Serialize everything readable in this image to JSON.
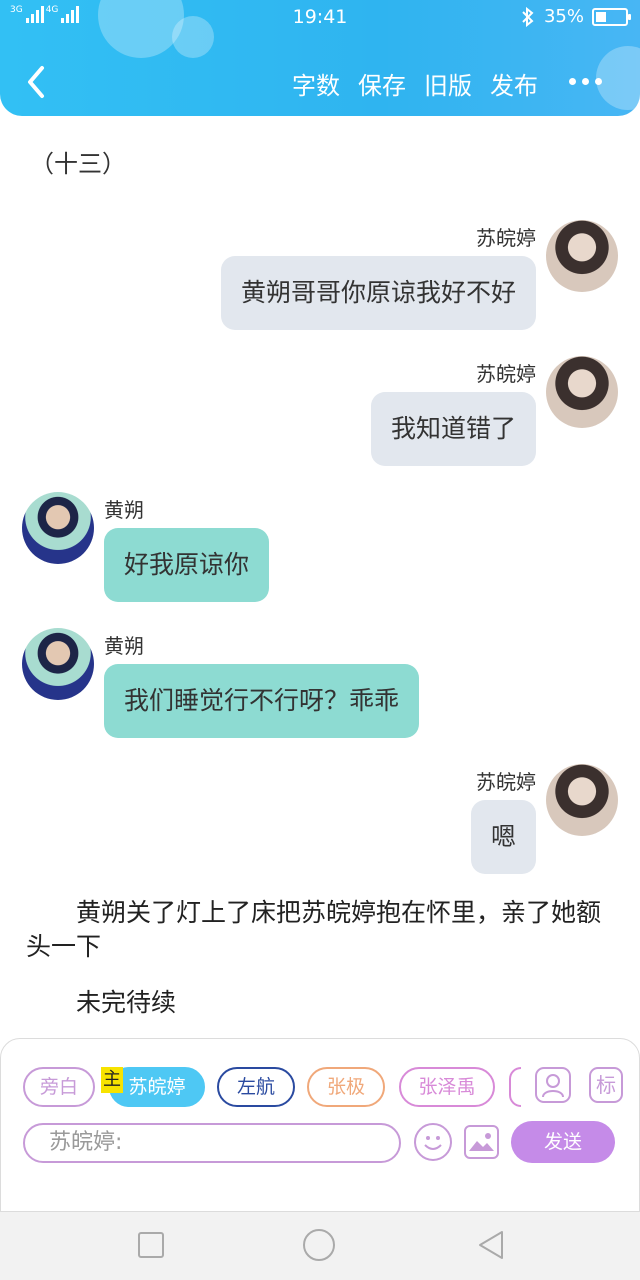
{
  "status_bar": {
    "network_1": "3G",
    "network_2": "4G",
    "time": "19:41",
    "battery": "35%",
    "battery_level": 0.35
  },
  "toolbar": {
    "actions": [
      "字数",
      "保存",
      "旧版",
      "发布"
    ],
    "back_icon": "chevron-left-icon",
    "more_icon": "more-dots-icon"
  },
  "story": {
    "chapter_title": "（十三）",
    "messages": [
      {
        "speaker": "苏皖婷",
        "text": "黄朔哥哥你原谅我好不好",
        "side": "right",
        "avatar": "avatar-girl"
      },
      {
        "speaker": "苏皖婷",
        "text": "我知道错了",
        "side": "right",
        "avatar": "avatar-girl"
      },
      {
        "speaker": "黄朔",
        "text": "好我原谅你",
        "side": "left",
        "avatar": "avatar-boy"
      },
      {
        "speaker": "黄朔",
        "text": "我们睡觉行不行呀？乖乖",
        "side": "left",
        "avatar": "avatar-boy"
      },
      {
        "speaker": "苏皖婷",
        "text": "嗯",
        "side": "right",
        "avatar": "avatar-girl"
      }
    ],
    "narration": [
      "　　黄朔关了灯上了床把苏皖婷抱在怀里，亲了她额头一下",
      "　　未完待续"
    ]
  },
  "composer": {
    "characters": [
      {
        "label": "旁白",
        "color": "#c79ad8"
      },
      {
        "label": "苏皖婷",
        "color": "#4ec8f4",
        "selected": true
      },
      {
        "label": "左航",
        "color": "#2a4aa0"
      },
      {
        "label": "张极",
        "color": "#f0a87a"
      },
      {
        "label": "张泽禹",
        "color": "#d88ad8"
      }
    ],
    "main_badge": "主",
    "role_icon_label": "标",
    "input_placeholder": "苏皖婷:",
    "send_label": "发送",
    "accent": "#c58be8"
  }
}
